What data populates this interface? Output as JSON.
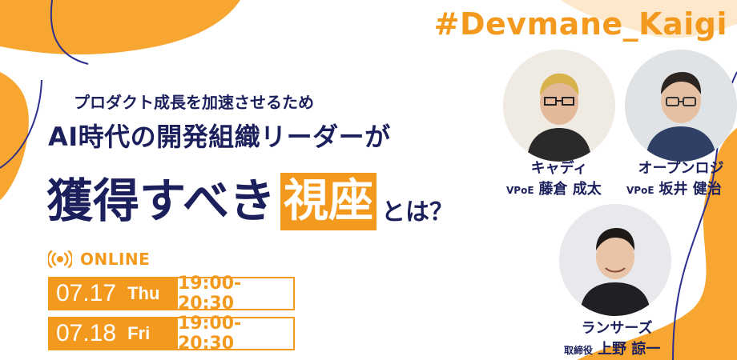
{
  "banner": {
    "hashtag": "#Devmane_Kaigi",
    "subtitle": "プロダクト成長を加速させるため",
    "title_line1": "AI時代の開発組織リーダーが",
    "title_line2_main": "獲得すべき",
    "title_line2_highlight": "視座",
    "title_line2_tail": "とは？",
    "online_label": "ONLINE"
  },
  "sessions": [
    {
      "date": "07.17",
      "day": "Thu",
      "time": "19:00-20:30"
    },
    {
      "date": "07.18",
      "day": "Fri",
      "time": "19:00-20:30"
    }
  ],
  "speakers": [
    {
      "company": "キャディ",
      "title": "VPoE",
      "name": "藤倉 成太"
    },
    {
      "company": "オープンロジ",
      "title": "VPoE",
      "name": "坂井 健治"
    },
    {
      "company": "ランサーズ",
      "title": "取締役",
      "name": "上野 諒一"
    }
  ],
  "colors": {
    "accent": "#f39a1e",
    "navy": "#1b1f5c",
    "line": "#2d2f8f"
  }
}
